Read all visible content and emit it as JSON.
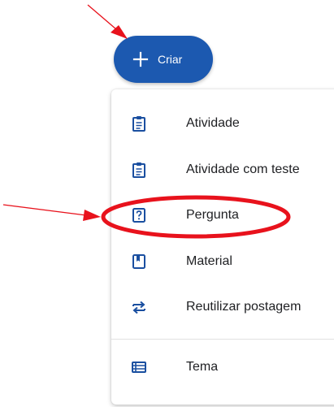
{
  "create_button": {
    "label": "Criar",
    "icon": "plus-icon"
  },
  "menu": {
    "items": [
      {
        "label": "Atividade",
        "icon": "assignment-icon"
      },
      {
        "label": "Atividade com teste",
        "icon": "quiz-assignment-icon"
      },
      {
        "label": "Pergunta",
        "icon": "question-icon"
      },
      {
        "label": "Material",
        "icon": "material-icon"
      },
      {
        "label": "Reutilizar postagem",
        "icon": "reuse-icon"
      }
    ],
    "footer_items": [
      {
        "label": "Tema",
        "icon": "topic-icon"
      }
    ]
  },
  "colors": {
    "accent": "#1c59b0",
    "annotation": "#e8121c",
    "text": "#202124",
    "icon": "#1a4fa0"
  }
}
